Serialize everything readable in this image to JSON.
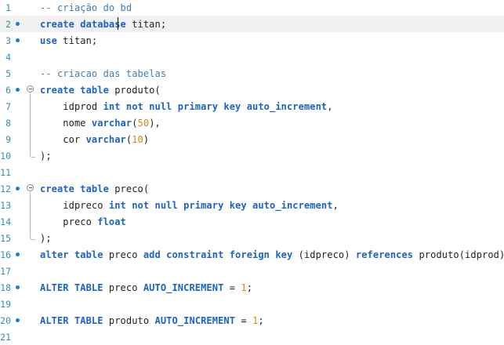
{
  "editor": {
    "lines": [
      {
        "n": "1",
        "bp": false,
        "fold": false,
        "active": false,
        "tokens": [
          {
            "t": "-- criação do bd",
            "c": "cm"
          }
        ]
      },
      {
        "n": "2",
        "bp": true,
        "fold": false,
        "active": true,
        "tokens": [
          {
            "t": "create database",
            "c": "kw"
          },
          {
            "t": " titan;",
            "c": "tx"
          }
        ]
      },
      {
        "n": "3",
        "bp": true,
        "fold": false,
        "active": false,
        "tokens": [
          {
            "t": "use",
            "c": "kw"
          },
          {
            "t": " titan;",
            "c": "tx"
          }
        ]
      },
      {
        "n": "4",
        "bp": false,
        "fold": false,
        "active": false,
        "tokens": []
      },
      {
        "n": "5",
        "bp": false,
        "fold": false,
        "active": false,
        "tokens": [
          {
            "t": "-- criacao das tabelas",
            "c": "cm"
          }
        ]
      },
      {
        "n": "6",
        "bp": true,
        "fold": true,
        "active": false,
        "tokens": [
          {
            "t": "create table",
            "c": "kw"
          },
          {
            "t": " produto(",
            "c": "tx"
          }
        ]
      },
      {
        "n": "7",
        "bp": false,
        "fold": false,
        "active": false,
        "tokens": [
          {
            "t": "    idprod ",
            "c": "tx"
          },
          {
            "t": "int not null primary key auto_increment",
            "c": "kw"
          },
          {
            "t": ",",
            "c": "tx"
          }
        ]
      },
      {
        "n": "8",
        "bp": false,
        "fold": false,
        "active": false,
        "tokens": [
          {
            "t": "    nome ",
            "c": "tx"
          },
          {
            "t": "varchar",
            "c": "kw"
          },
          {
            "t": "(",
            "c": "tx"
          },
          {
            "t": "50",
            "c": "num"
          },
          {
            "t": "),",
            "c": "tx"
          }
        ]
      },
      {
        "n": "9",
        "bp": false,
        "fold": false,
        "active": false,
        "tokens": [
          {
            "t": "    cor ",
            "c": "tx"
          },
          {
            "t": "varchar",
            "c": "kw"
          },
          {
            "t": "(",
            "c": "tx"
          },
          {
            "t": "10",
            "c": "num"
          },
          {
            "t": ")",
            "c": "tx"
          }
        ]
      },
      {
        "n": "10",
        "bp": false,
        "fold": false,
        "active": false,
        "tokens": [
          {
            "t": ");",
            "c": "tx"
          }
        ]
      },
      {
        "n": "11",
        "bp": false,
        "fold": false,
        "active": false,
        "tokens": []
      },
      {
        "n": "12",
        "bp": true,
        "fold": true,
        "active": false,
        "tokens": [
          {
            "t": "create table",
            "c": "kw"
          },
          {
            "t": " preco(",
            "c": "tx"
          }
        ]
      },
      {
        "n": "13",
        "bp": false,
        "fold": false,
        "active": false,
        "tokens": [
          {
            "t": "    idpreco ",
            "c": "tx"
          },
          {
            "t": "int not null primary key auto_increment",
            "c": "kw"
          },
          {
            "t": ",",
            "c": "tx"
          }
        ]
      },
      {
        "n": "14",
        "bp": false,
        "fold": false,
        "active": false,
        "tokens": [
          {
            "t": "    preco ",
            "c": "tx"
          },
          {
            "t": "float",
            "c": "kw"
          }
        ]
      },
      {
        "n": "15",
        "bp": false,
        "fold": false,
        "active": false,
        "tokens": [
          {
            "t": ");",
            "c": "tx"
          }
        ]
      },
      {
        "n": "16",
        "bp": true,
        "fold": false,
        "active": false,
        "tokens": [
          {
            "t": "alter table",
            "c": "kw"
          },
          {
            "t": " preco ",
            "c": "tx"
          },
          {
            "t": "add constraint foreign key",
            "c": "kw"
          },
          {
            "t": " (idpreco) ",
            "c": "tx"
          },
          {
            "t": "references",
            "c": "kw"
          },
          {
            "t": " produto(idprod);",
            "c": "tx"
          }
        ]
      },
      {
        "n": "17",
        "bp": false,
        "fold": false,
        "active": false,
        "tokens": []
      },
      {
        "n": "18",
        "bp": true,
        "fold": false,
        "active": false,
        "tokens": [
          {
            "t": "ALTER TABLE",
            "c": "kw"
          },
          {
            "t": " preco ",
            "c": "tx"
          },
          {
            "t": "AUTO_INCREMENT",
            "c": "kw"
          },
          {
            "t": " = ",
            "c": "tx"
          },
          {
            "t": "1",
            "c": "num"
          },
          {
            "t": ";",
            "c": "tx"
          }
        ]
      },
      {
        "n": "19",
        "bp": false,
        "fold": false,
        "active": false,
        "tokens": []
      },
      {
        "n": "20",
        "bp": true,
        "fold": false,
        "active": false,
        "tokens": [
          {
            "t": "ALTER TABLE",
            "c": "kw"
          },
          {
            "t": " produto ",
            "c": "tx"
          },
          {
            "t": "AUTO_INCREMENT",
            "c": "kw"
          },
          {
            "t": " = ",
            "c": "tx"
          },
          {
            "t": "1",
            "c": "num"
          },
          {
            "t": ";",
            "c": "tx"
          }
        ]
      },
      {
        "n": "21",
        "bp": false,
        "fold": false,
        "active": false,
        "tokens": []
      }
    ]
  },
  "colors": {
    "keyword": "#1a62c7",
    "comment": "#3c7fb3",
    "number": "#d2861f",
    "line_number": "#2b91af",
    "breakpoint": "#1a7cd0",
    "active_line": "#f1f1f1"
  }
}
